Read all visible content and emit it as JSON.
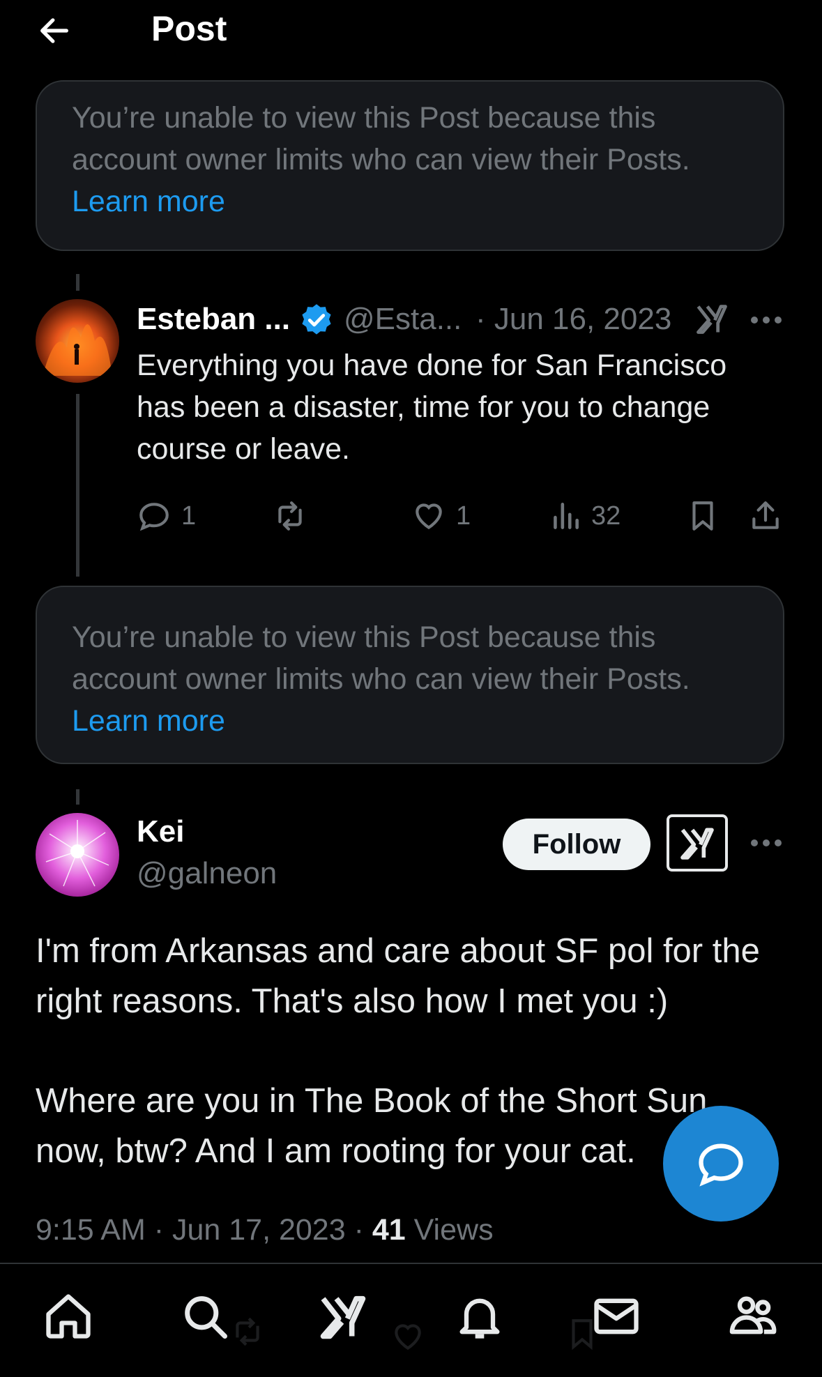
{
  "header": {
    "title": "Post"
  },
  "notices": [
    {
      "text": "You’re unable to view this Post because this account owner limits who can view their Posts.",
      "link": "Learn more"
    },
    {
      "text": "You’re unable to view this Post because this account owner limits who can view their Posts.",
      "link": "Learn more"
    }
  ],
  "reply": {
    "name": "Esteban ...",
    "handle": "@Esta...",
    "date": "· Jun 16, 2023",
    "text": "Everything you have done for San Francisco has been a disaster, time for you to change course or leave.",
    "reply_count": "1",
    "like_count": "1",
    "views": "32"
  },
  "main_post": {
    "name": "Kei",
    "handle": "@galneon",
    "follow_label": "Follow",
    "paragraph1": "I'm from Arkansas and care about SF pol for the right reasons. That's also how I met you :)",
    "paragraph2": "Where are you in The Book of the Short Sun now, btw? And I am rooting for your cat.",
    "time": "9:15 AM · Jun 17, 2023 · ",
    "views_count": "41",
    "views_label": " Views"
  },
  "colors": {
    "background": "#000000",
    "accent": "#1d9bf0",
    "muted": "#71767b",
    "card": "#16181c"
  },
  "nav_icons": [
    "home-icon",
    "search-icon",
    "grok-icon",
    "notifications-icon",
    "messages-icon",
    "communities-icon"
  ]
}
